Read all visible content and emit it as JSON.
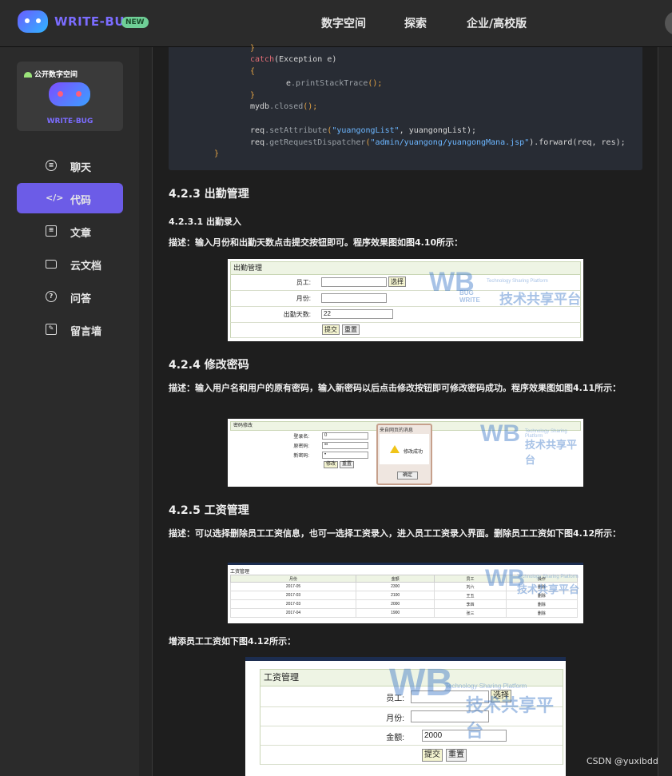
{
  "header": {
    "brand": "WRITE-BUG",
    "badge": "NEW",
    "nav": [
      "数字空间",
      "探索",
      "企业/高校版"
    ]
  },
  "sidebar": {
    "card_label": "公开数字空间",
    "card_name": "WRITE-BUG",
    "items": [
      {
        "label": "聊天",
        "icon": "chat-icon"
      },
      {
        "label": "代码",
        "icon": "code-icon",
        "active": true
      },
      {
        "label": "文章",
        "icon": "article-icon"
      },
      {
        "label": "云文档",
        "icon": "folder-icon"
      },
      {
        "label": "问答",
        "icon": "question-icon"
      },
      {
        "label": "留言墙",
        "icon": "edit-icon"
      }
    ]
  },
  "code": {
    "l1": "}",
    "l2a": "catch",
    "l2b": "(Exception e)",
    "l3": "{",
    "l4a": "e",
    "l4b": ".printStackTrace",
    "l4c": "();",
    "l5": "}",
    "l6a": "mydb",
    "l6b": ".closed",
    "l6c": "();",
    "l7a": "req",
    "l7b": ".setAttribute",
    "l7c": "(",
    "l7d": "\"yuangongList\"",
    "l7e": ", yuangongList);",
    "l8a": "req",
    "l8b": ".getRequestDispatcher",
    "l8c": "(",
    "l8d": "\"admin/yuangong/yuangongMana.jsp\"",
    "l8e": ").forward(req, res);",
    "l9": "}"
  },
  "article": {
    "h_423": "4.2.3 出勤管理",
    "h_4231": "4.2.3.1 出勤录入",
    "p_4231": "描述：输入月份和出勤天数点击提交按钮即可。程序效果图如图4.10所示：",
    "h_424": "4.2.4 修改密码",
    "p_424": "描述：输入用户名和用户的原有密码，输入新密码以后点击修改按钮即可修改密码成功。程序效果图如图4.11所示：",
    "h_425": "4.2.5 工资管理",
    "p_425": "描述：可以选择删除员工工资信息，也可一选择工资录入，进入员工工资录入界面。删除员工工资如下图4.12所示：",
    "p_add": "增添员工工资如下图4.12所示："
  },
  "fig_attendance": {
    "title": "出勤管理",
    "employee_label": "员工:",
    "select_btn": "选择",
    "month_label": "月份:",
    "days_label": "出勤天数:",
    "days_value": "22",
    "submit": "提交",
    "reset": "重置"
  },
  "fig_password": {
    "title": "密码修改",
    "user_label": "登录名:",
    "old_label": "原密码:",
    "new_label": "新密码:",
    "user_value": "0",
    "old_value": "••",
    "new_value": "•",
    "submit": "修改",
    "reset": "重置",
    "dialog_title": "来自网页的消息",
    "dialog_msg": "修改成功",
    "dialog_ok": "确定"
  },
  "fig_salary_list": {
    "title": "工资管理",
    "headers": [
      "月份",
      "金额",
      "员工",
      "操作"
    ],
    "rows": [
      [
        "2017-05",
        "2300",
        "刘六",
        "删除"
      ],
      [
        "2017-03",
        "2100",
        "王五",
        "删除"
      ],
      [
        "2017-03",
        "2000",
        "李四",
        "删除"
      ],
      [
        "2017-04",
        "1900",
        "张三",
        "删除"
      ]
    ]
  },
  "fig_salary_add": {
    "title": "工资管理",
    "employee_label": "员工:",
    "select_btn": "选择",
    "month_label": "月份:",
    "amount_label": "金额:",
    "amount_value": "2000",
    "submit": "提交",
    "reset": "重置"
  },
  "watermark": {
    "tagline": "Technology Sharing Platform",
    "text": "技术共享平台",
    "logo_b": "WB",
    "logo_bug": "BUG",
    "logo_write": "WRITE"
  },
  "footer": {
    "credit": "CSDN @yuxibdd"
  }
}
